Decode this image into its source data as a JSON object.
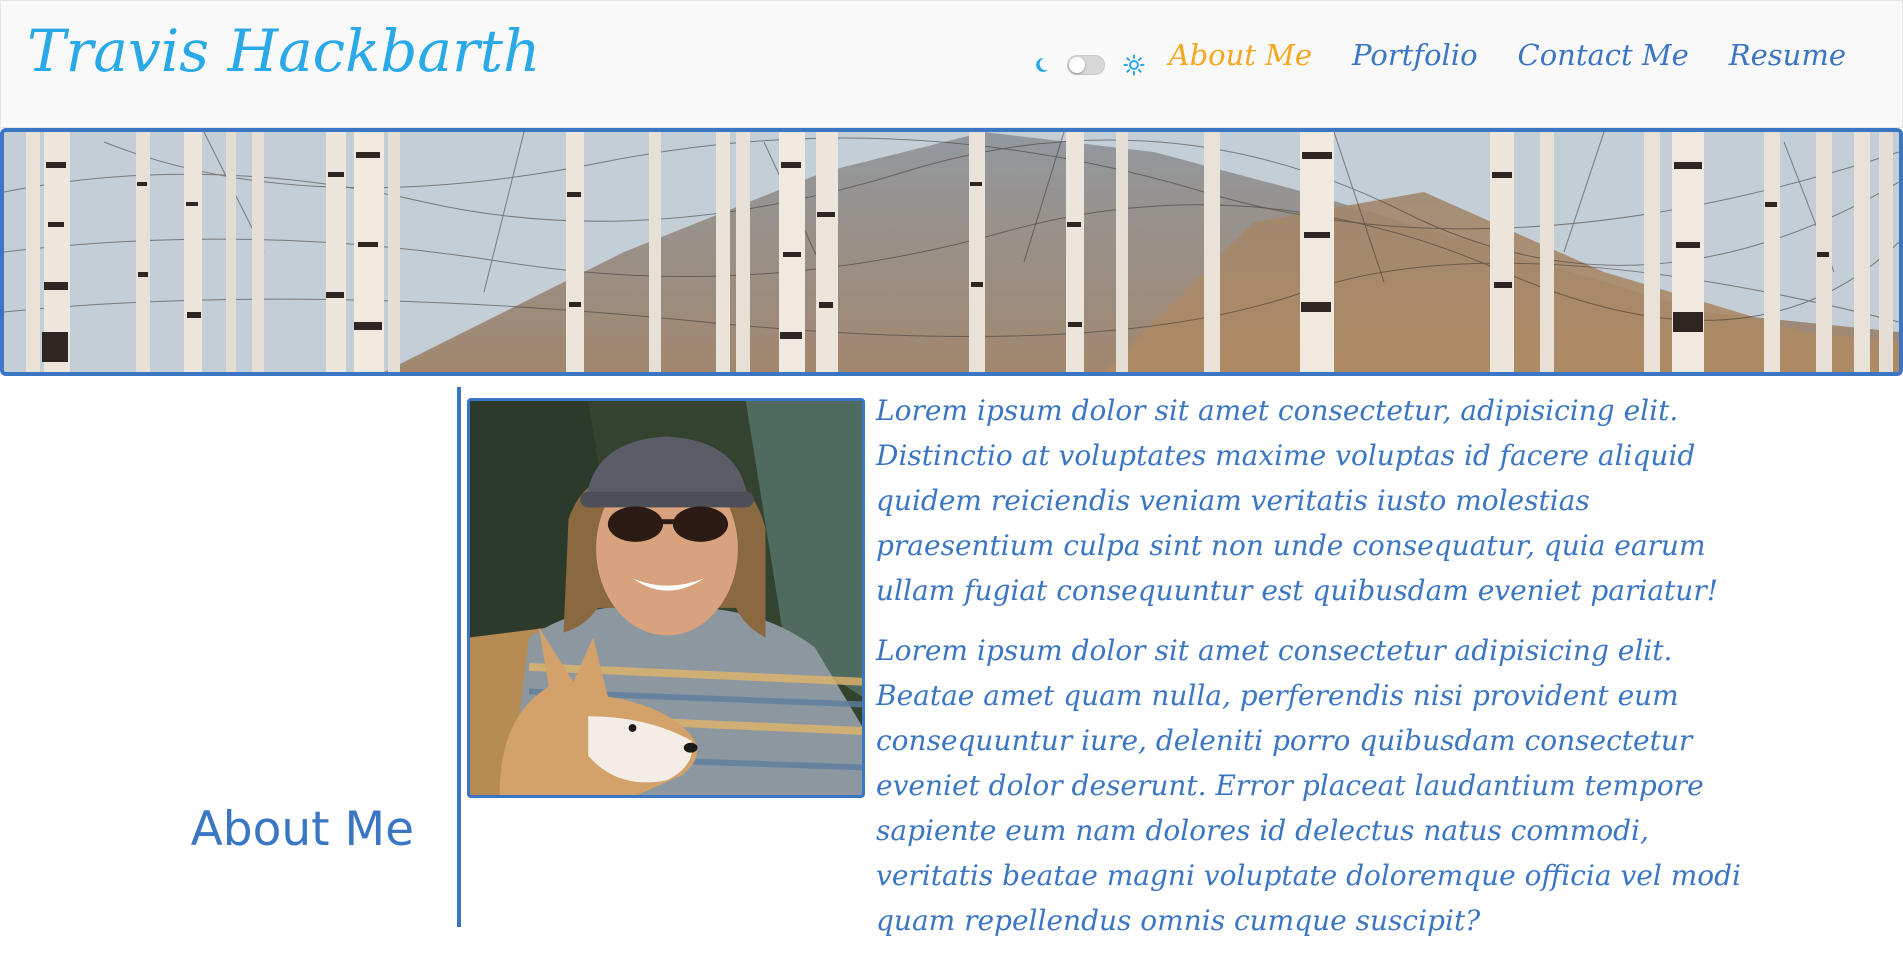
{
  "header": {
    "site_title": "Travis Hackbarth",
    "theme_toggle": {
      "dark_icon": "moon-icon",
      "light_icon": "sun-icon",
      "state": "off"
    },
    "nav": [
      {
        "label": "About Me",
        "active": true
      },
      {
        "label": "Portfolio",
        "active": false
      },
      {
        "label": "Contact Me",
        "active": false
      },
      {
        "label": "Resume",
        "active": false
      }
    ]
  },
  "banner": {
    "image": "birch-forest-mountain-banner"
  },
  "about": {
    "heading": "About Me",
    "photo": "profile-photo-man-with-dog",
    "paragraphs": [
      "Lorem ipsum dolor sit amet consectetur, adipisicing elit. Distinctio at voluptates maxime voluptas id facere aliquid quidem reiciendis veniam veritatis iusto molestias praesentium culpa sint non unde consequatur, quia earum ullam fugiat consequuntur est quibusdam eveniet pariatur!",
      "Lorem ipsum dolor sit amet consectetur adipisicing elit. Beatae amet quam nulla, perferendis nisi provident eum consequuntur iure, deleniti porro quibusdam consectetur eveniet dolor deserunt. Error placeat laudantium tempore sapiente eum nam dolores id delectus natus commodi, veritatis beatae magni voluptate doloremque officia vel modi quam repellendus omnis cumque suscipit?"
    ]
  },
  "colors": {
    "title": "#2aa9e8",
    "accent": "#3a76c4",
    "active_nav": "#f5a623",
    "header_bg": "#f9f9f9"
  }
}
